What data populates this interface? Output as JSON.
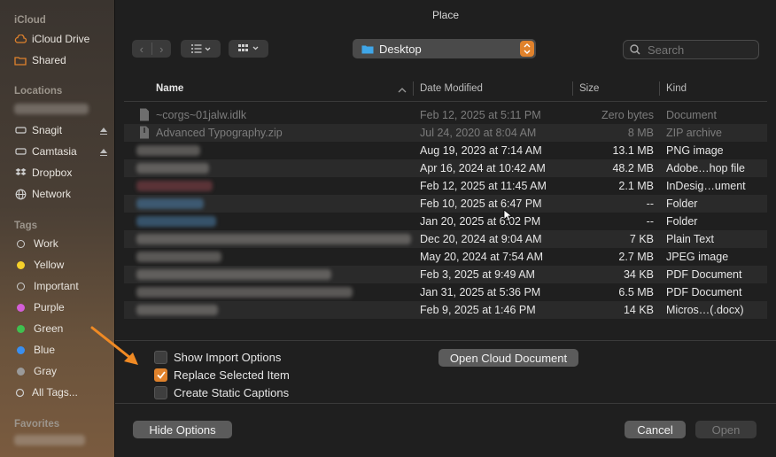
{
  "window": {
    "title": "Place"
  },
  "sidebar": {
    "sections": {
      "icloud": "iCloud",
      "locations": "Locations",
      "tags": "Tags",
      "favorites": "Favorites"
    },
    "icloud_items": [
      {
        "label": "iCloud Drive",
        "icon": "cloud-icon"
      },
      {
        "label": "Shared",
        "icon": "shared-folder-icon"
      }
    ],
    "location_items": [
      {
        "label": "Snagit",
        "icon": "drive-icon"
      },
      {
        "label": "Camtasia",
        "icon": "drive-icon"
      },
      {
        "label": "Dropbox",
        "icon": "dropbox-icon"
      },
      {
        "label": "Network",
        "icon": "network-icon"
      }
    ],
    "tag_items": [
      {
        "label": "Work",
        "color": ""
      },
      {
        "label": "Yellow",
        "color": "#f5d02a"
      },
      {
        "label": "Important",
        "color": ""
      },
      {
        "label": "Purple",
        "color": "#d35ed8"
      },
      {
        "label": "Green",
        "color": "#3fc04f"
      },
      {
        "label": "Blue",
        "color": "#3a8ff0"
      },
      {
        "label": "Gray",
        "color": "#9a9a9a"
      },
      {
        "label": "All Tags...",
        "color": ""
      }
    ]
  },
  "toolbar": {
    "location": "Desktop",
    "search_placeholder": "Search"
  },
  "columns": {
    "name": "Name",
    "date": "Date Modified",
    "size": "Size",
    "kind": "Kind"
  },
  "files": [
    {
      "name": "~corgs~01jalw.idlk",
      "date": "Feb 12, 2025 at 5:11 PM",
      "size": "Zero bytes",
      "kind": "Document"
    },
    {
      "name": "Advanced Typography.zip",
      "date": "Jul 24, 2020 at 8:04 AM",
      "size": "8 MB",
      "kind": "ZIP archive"
    },
    {
      "name": "",
      "date": "Aug 19, 2023 at 7:14 AM",
      "size": "13.1 MB",
      "kind": "PNG image"
    },
    {
      "name": "",
      "date": "Apr 16, 2024 at 10:42 AM",
      "size": "48.2 MB",
      "kind": "Adobe…hop file"
    },
    {
      "name": "",
      "date": "Feb 12, 2025 at 11:45 AM",
      "size": "2.1 MB",
      "kind": "InDesig…ument"
    },
    {
      "name": "",
      "date": "Feb 10, 2025 at 6:47 PM",
      "size": "--",
      "kind": "Folder"
    },
    {
      "name": "",
      "date": "Jan 20, 2025 at 6:02 PM",
      "size": "--",
      "kind": "Folder"
    },
    {
      "name": "",
      "date": "Dec 20, 2024 at 9:04 AM",
      "size": "7 KB",
      "kind": "Plain Text"
    },
    {
      "name": "",
      "date": "May 20, 2024 at 7:54 AM",
      "size": "2.7 MB",
      "kind": "JPEG image"
    },
    {
      "name": "",
      "date": "Feb 3, 2025 at 9:49 AM",
      "size": "34 KB",
      "kind": "PDF Document"
    },
    {
      "name": "",
      "date": "Jan 31, 2025 at 5:36 PM",
      "size": "6.5 MB",
      "kind": "PDF Document"
    },
    {
      "name": "",
      "date": "Feb 9, 2025 at 1:46 PM",
      "size": "14 KB",
      "kind": "Micros…(.docx)"
    }
  ],
  "options": {
    "show_import": "Show Import Options",
    "replace_selected": "Replace Selected Item",
    "static_captions": "Create Static Captions",
    "open_cloud": "Open Cloud Document"
  },
  "buttons": {
    "hide_options": "Hide Options",
    "cancel": "Cancel",
    "open": "Open"
  },
  "colors": {
    "accent": "#e0822c",
    "arrow": "#f08a24"
  }
}
